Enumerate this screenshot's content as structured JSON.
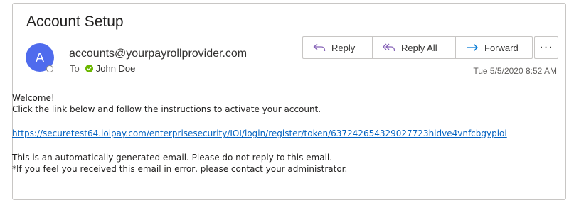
{
  "email": {
    "subject": "Account Setup",
    "sender_initial": "A",
    "sender": "accounts@yourpayrollprovider.com",
    "to_label": "To",
    "recipient": "John Doe",
    "date": "Tue 5/5/2020 8:52 AM"
  },
  "actions": {
    "reply": "Reply",
    "reply_all": "Reply All",
    "forward": "Forward",
    "more": "···"
  },
  "body": {
    "greeting": "Welcome!",
    "instructions": "Click the link below and follow the instructions to activate your account.",
    "link": "https://securetest64.ioipay.com/enterprisesecurity/IOI/login/register/token/637242654329027723hldve4vnfcbgypioi",
    "notice": "This is an automatically generated email. Please do not reply to this email.",
    "footer": "*If you feel you received this email in error, please contact your administrator."
  },
  "colors": {
    "avatar": "#4f6bed",
    "presence_check": "#6bb700",
    "link": "#0563c1",
    "accent_icon": "#8764b8",
    "forward_icon": "#0078d4"
  }
}
